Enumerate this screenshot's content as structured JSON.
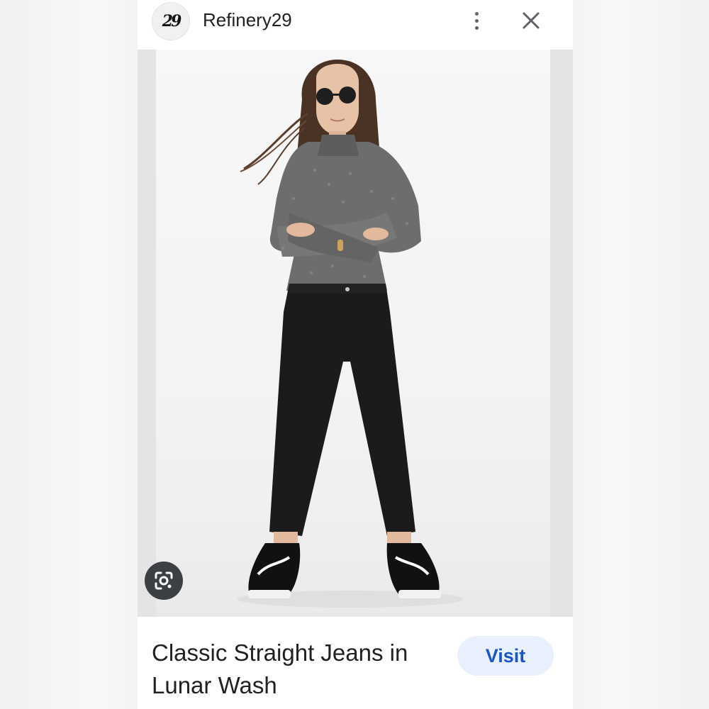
{
  "header": {
    "logo_text": "29",
    "site_name": "Refinery29",
    "more_icon": "more-vert-icon",
    "close_icon": "close-icon"
  },
  "image": {
    "description_icon": "google-lens-icon"
  },
  "result": {
    "title": "Classic Straight Jeans in Lunar Wash",
    "visit_label": "Visit"
  },
  "colors": {
    "visit_bg": "#e8f0fe",
    "visit_text": "#1a56c6",
    "lens_bg": "#3c3f43",
    "title_text": "#202124"
  }
}
